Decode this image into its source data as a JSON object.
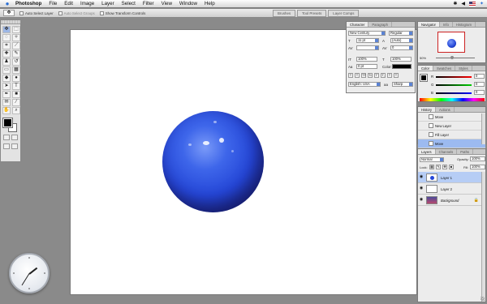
{
  "menubar": {
    "app_name": "Photoshop",
    "items": [
      "File",
      "Edit",
      "Image",
      "Layer",
      "Select",
      "Filter",
      "View",
      "Window",
      "Help"
    ]
  },
  "options_bar": {
    "tool_preset_icon": "move-tool-icon",
    "auto_select_layer": "Auto Select Layer",
    "auto_select_groups": "Auto Select Groups",
    "show_transform_controls": "Show Transform Controls"
  },
  "palette_well": {
    "tabs": [
      "Brushes",
      "Tool Presets",
      "Layer Comps"
    ]
  },
  "character_panel": {
    "tabs": [
      "Character",
      "Paragraph"
    ],
    "font_family": "New Century",
    "font_style": "Regular",
    "font_size": "11 pt",
    "leading": "(Auto)",
    "kerning": "",
    "tracking": "0",
    "vertical_scale": "100%",
    "horizontal_scale": "100%",
    "baseline_shift": "0 pt",
    "color_label": "Color:",
    "style_buttons": [
      "T",
      "T",
      "TT",
      "Tr",
      "T'",
      "T,",
      "T",
      "T"
    ],
    "language": "English: USA",
    "antialias_label": "aa",
    "antialias": "Sharp"
  },
  "navigator_panel": {
    "tabs": [
      "Navigator",
      "Info",
      "Histogram"
    ],
    "zoom": "50%"
  },
  "color_panel": {
    "tabs": [
      "Color",
      "Swatches",
      "Styles"
    ],
    "channels": [
      {
        "label": "R",
        "value": "0"
      },
      {
        "label": "G",
        "value": "0"
      },
      {
        "label": "B",
        "value": "0"
      }
    ]
  },
  "history_panel": {
    "tabs": [
      "History",
      "Actions"
    ],
    "steps": [
      "Move",
      "New Layer",
      "Fill Layer",
      "Move"
    ],
    "selected_index": 3
  },
  "layers_panel": {
    "tabs": [
      "Layers",
      "Channels",
      "Paths"
    ],
    "blend_mode": "Normal",
    "opacity_label": "Opacity:",
    "opacity": "100%",
    "lock_label": "Lock:",
    "fill_label": "Fill:",
    "fill": "100%",
    "layers": [
      {
        "name": "Layer 1",
        "selected": true
      },
      {
        "name": "Layer 2",
        "selected": false
      },
      {
        "name": "Background",
        "selected": false
      }
    ]
  },
  "colors": {
    "accent": "#3e66ea",
    "selection": "#9cbaf0"
  }
}
